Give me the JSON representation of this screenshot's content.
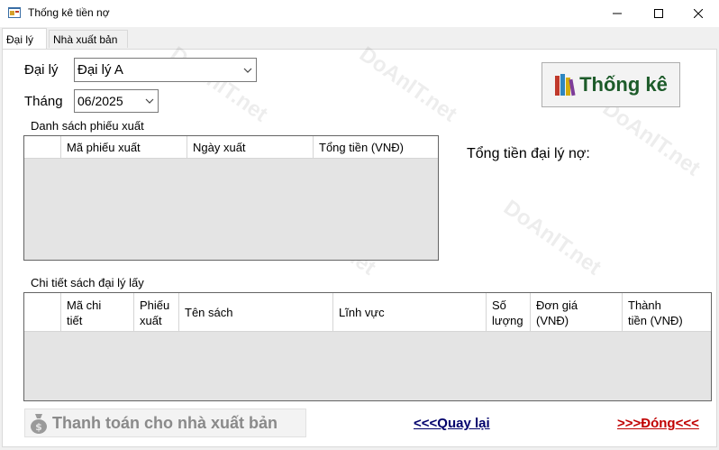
{
  "window": {
    "title": "Thống kê tiền nợ",
    "minimize_icon": "minimize-icon",
    "maximize_icon": "maximize-icon",
    "close_icon": "close-icon"
  },
  "tabs": [
    {
      "label": "Đại lý",
      "active": true
    },
    {
      "label": "Nhà xuất bản",
      "active": false
    }
  ],
  "filters": {
    "agent_label": "Đại lý",
    "agent_value": "Đại lý A",
    "month_label": "Tháng",
    "month_value": "06/2025"
  },
  "stat_button": {
    "label": "Thống kê",
    "icon": "books-icon"
  },
  "export_list": {
    "caption": "Danh sách phiếu xuất",
    "columns": [
      "Mã phiếu xuất",
      "Ngày xuất",
      "Tổng tiền (VNĐ)"
    ],
    "rows": []
  },
  "summary": {
    "label": "Tổng tiền đại lý nợ:"
  },
  "detail_list": {
    "caption": "Chi tiết sách đại lý lấy",
    "columns": [
      [
        "Mã chi",
        "tiết"
      ],
      [
        "Phiếu",
        "xuất"
      ],
      [
        "Tên sách",
        ""
      ],
      [
        "Lĩnh vực",
        ""
      ],
      [
        "Số",
        "lượng"
      ],
      [
        "Đơn giá",
        "(VNĐ)"
      ],
      [
        "Thành",
        "tiền (VNĐ)"
      ]
    ],
    "rows": []
  },
  "pay_button": {
    "label": "Thanh toán cho nhà xuất bản",
    "icon": "money-bag-icon"
  },
  "back_link": {
    "label": "<<<Quay lại",
    "color": "#00006b"
  },
  "close_link": {
    "label": ">>>Đóng<<<",
    "color": "#c00000"
  },
  "watermark": "DoAnIT.net",
  "colors": {
    "accent_green": "#1d5b2a",
    "header_bg": "#ffffff",
    "grid_bg": "#e4e4e4"
  }
}
